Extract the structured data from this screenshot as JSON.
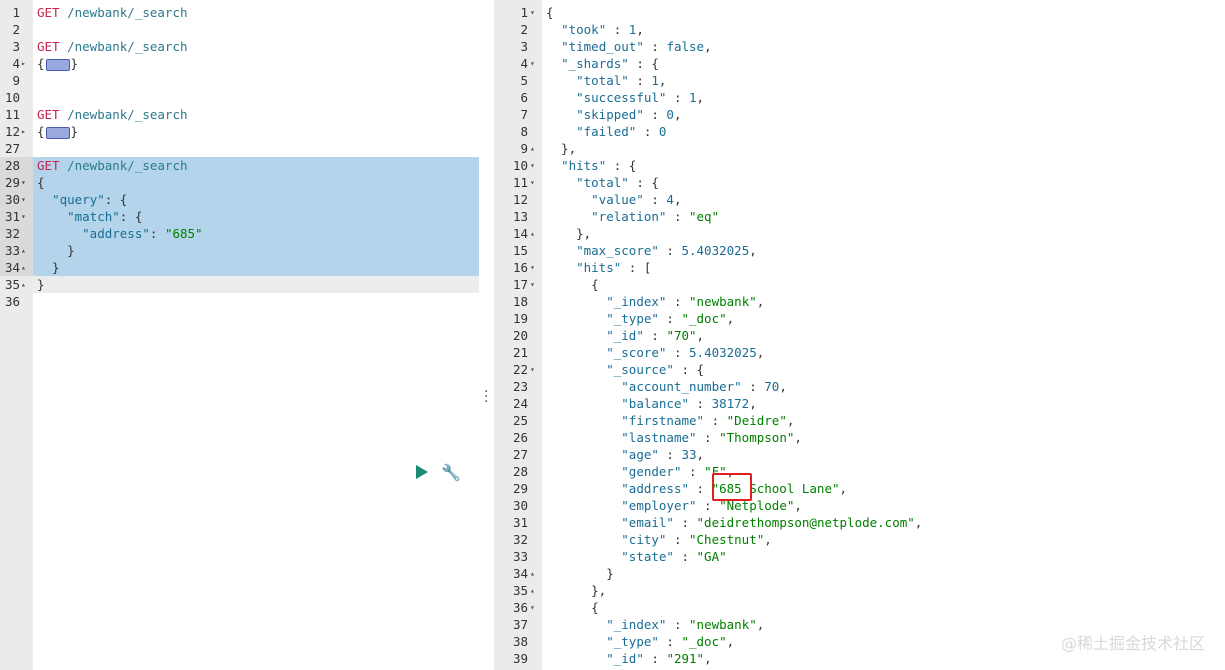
{
  "request_editor": {
    "lines": [
      {
        "n": "1",
        "fold": "",
        "parts": [
          [
            "k-method",
            "GET"
          ],
          [
            "k-path",
            " /newbank/_search"
          ]
        ]
      },
      {
        "n": "2",
        "fold": "",
        "parts": []
      },
      {
        "n": "3",
        "fold": "",
        "parts": [
          [
            "k-method",
            "GET"
          ],
          [
            "k-path",
            " /newbank/_search"
          ]
        ]
      },
      {
        "n": "4",
        "fold": "▸",
        "parts": [
          [
            "k-punc",
            "{"
          ],
          [
            "widget",
            ""
          ],
          [
            "k-punc",
            "}"
          ]
        ]
      },
      {
        "n": "9",
        "fold": "",
        "parts": []
      },
      {
        "n": "10",
        "fold": "",
        "parts": []
      },
      {
        "n": "11",
        "fold": "",
        "parts": [
          [
            "k-method",
            "GET"
          ],
          [
            "k-path",
            " /newbank/_search"
          ]
        ]
      },
      {
        "n": "12",
        "fold": "▸",
        "parts": [
          [
            "k-punc",
            "{"
          ],
          [
            "widget",
            ""
          ],
          [
            "k-punc",
            "}"
          ]
        ]
      },
      {
        "n": "27",
        "fold": "",
        "parts": []
      },
      {
        "n": "28",
        "fold": "",
        "sel": true,
        "parts": [
          [
            "k-method",
            "GET"
          ],
          [
            "k-path",
            " /newbank/_search"
          ]
        ]
      },
      {
        "n": "29",
        "fold": "▾",
        "sel": true,
        "parts": [
          [
            "k-punc",
            "{"
          ]
        ]
      },
      {
        "n": "30",
        "fold": "▾",
        "sel": true,
        "parts": [
          [
            "k-punc",
            "  "
          ],
          [
            "k-key",
            "\"query\""
          ],
          [
            "k-punc",
            ": {"
          ]
        ]
      },
      {
        "n": "31",
        "fold": "▾",
        "sel": true,
        "parts": [
          [
            "k-punc",
            "    "
          ],
          [
            "k-key",
            "\"match\""
          ],
          [
            "k-punc",
            ": {"
          ]
        ]
      },
      {
        "n": "32",
        "fold": "",
        "sel": true,
        "parts": [
          [
            "k-punc",
            "      "
          ],
          [
            "k-key",
            "\"address\""
          ],
          [
            "k-punc",
            ": "
          ],
          [
            "k-str",
            "\"685\""
          ]
        ]
      },
      {
        "n": "33",
        "fold": "▴",
        "sel": true,
        "parts": [
          [
            "k-punc",
            "    }"
          ]
        ]
      },
      {
        "n": "34",
        "fold": "▴",
        "sel": true,
        "parts": [
          [
            "k-punc",
            "  }"
          ]
        ]
      },
      {
        "n": "35",
        "fold": "▴",
        "cur": true,
        "parts": [
          [
            "k-punc",
            "}"
          ]
        ]
      },
      {
        "n": "36",
        "fold": "",
        "parts": []
      }
    ]
  },
  "response_viewer": {
    "lines": [
      {
        "n": "1",
        "fold": "▾",
        "parts": [
          [
            "k-punc",
            "{"
          ]
        ]
      },
      {
        "n": "2",
        "fold": "",
        "parts": [
          [
            "k-punc",
            "  "
          ],
          [
            "k-key",
            "\"took\""
          ],
          [
            "k-punc",
            " : "
          ],
          [
            "k-num",
            "1"
          ],
          [
            "k-punc",
            ","
          ]
        ]
      },
      {
        "n": "3",
        "fold": "",
        "parts": [
          [
            "k-punc",
            "  "
          ],
          [
            "k-key",
            "\"timed_out\""
          ],
          [
            "k-punc",
            " : "
          ],
          [
            "k-num",
            "false"
          ],
          [
            "k-punc",
            ","
          ]
        ]
      },
      {
        "n": "4",
        "fold": "▾",
        "parts": [
          [
            "k-punc",
            "  "
          ],
          [
            "k-key",
            "\"_shards\""
          ],
          [
            "k-punc",
            " : {"
          ]
        ]
      },
      {
        "n": "5",
        "fold": "",
        "parts": [
          [
            "k-punc",
            "    "
          ],
          [
            "k-key",
            "\"total\""
          ],
          [
            "k-punc",
            " : "
          ],
          [
            "k-num",
            "1"
          ],
          [
            "k-punc",
            ","
          ]
        ]
      },
      {
        "n": "6",
        "fold": "",
        "parts": [
          [
            "k-punc",
            "    "
          ],
          [
            "k-key",
            "\"successful\""
          ],
          [
            "k-punc",
            " : "
          ],
          [
            "k-num",
            "1"
          ],
          [
            "k-punc",
            ","
          ]
        ]
      },
      {
        "n": "7",
        "fold": "",
        "parts": [
          [
            "k-punc",
            "    "
          ],
          [
            "k-key",
            "\"skipped\""
          ],
          [
            "k-punc",
            " : "
          ],
          [
            "k-num",
            "0"
          ],
          [
            "k-punc",
            ","
          ]
        ]
      },
      {
        "n": "8",
        "fold": "",
        "parts": [
          [
            "k-punc",
            "    "
          ],
          [
            "k-key",
            "\"failed\""
          ],
          [
            "k-punc",
            " : "
          ],
          [
            "k-num",
            "0"
          ]
        ]
      },
      {
        "n": "9",
        "fold": "▴",
        "parts": [
          [
            "k-punc",
            "  },"
          ]
        ]
      },
      {
        "n": "10",
        "fold": "▾",
        "parts": [
          [
            "k-punc",
            "  "
          ],
          [
            "k-key",
            "\"hits\""
          ],
          [
            "k-punc",
            " : {"
          ]
        ]
      },
      {
        "n": "11",
        "fold": "▾",
        "parts": [
          [
            "k-punc",
            "    "
          ],
          [
            "k-key",
            "\"total\""
          ],
          [
            "k-punc",
            " : {"
          ]
        ]
      },
      {
        "n": "12",
        "fold": "",
        "parts": [
          [
            "k-punc",
            "      "
          ],
          [
            "k-key",
            "\"value\""
          ],
          [
            "k-punc",
            " : "
          ],
          [
            "k-num",
            "4"
          ],
          [
            "k-punc",
            ","
          ]
        ]
      },
      {
        "n": "13",
        "fold": "",
        "parts": [
          [
            "k-punc",
            "      "
          ],
          [
            "k-key",
            "\"relation\""
          ],
          [
            "k-punc",
            " : "
          ],
          [
            "k-str",
            "\"eq\""
          ]
        ]
      },
      {
        "n": "14",
        "fold": "▴",
        "parts": [
          [
            "k-punc",
            "    },"
          ]
        ]
      },
      {
        "n": "15",
        "fold": "",
        "parts": [
          [
            "k-punc",
            "    "
          ],
          [
            "k-key",
            "\"max_score\""
          ],
          [
            "k-punc",
            " : "
          ],
          [
            "k-num",
            "5.4032025"
          ],
          [
            "k-punc",
            ","
          ]
        ]
      },
      {
        "n": "16",
        "fold": "▾",
        "parts": [
          [
            "k-punc",
            "    "
          ],
          [
            "k-key",
            "\"hits\""
          ],
          [
            "k-punc",
            " : ["
          ]
        ]
      },
      {
        "n": "17",
        "fold": "▾",
        "parts": [
          [
            "k-punc",
            "      {"
          ]
        ]
      },
      {
        "n": "18",
        "fold": "",
        "parts": [
          [
            "k-punc",
            "        "
          ],
          [
            "k-key",
            "\"_index\""
          ],
          [
            "k-punc",
            " : "
          ],
          [
            "k-str",
            "\"newbank\""
          ],
          [
            "k-punc",
            ","
          ]
        ]
      },
      {
        "n": "19",
        "fold": "",
        "parts": [
          [
            "k-punc",
            "        "
          ],
          [
            "k-key",
            "\"_type\""
          ],
          [
            "k-punc",
            " : "
          ],
          [
            "k-str",
            "\"_doc\""
          ],
          [
            "k-punc",
            ","
          ]
        ]
      },
      {
        "n": "20",
        "fold": "",
        "parts": [
          [
            "k-punc",
            "        "
          ],
          [
            "k-key",
            "\"_id\""
          ],
          [
            "k-punc",
            " : "
          ],
          [
            "k-str",
            "\"70\""
          ],
          [
            "k-punc",
            ","
          ]
        ]
      },
      {
        "n": "21",
        "fold": "",
        "parts": [
          [
            "k-punc",
            "        "
          ],
          [
            "k-key",
            "\"_score\""
          ],
          [
            "k-punc",
            " : "
          ],
          [
            "k-num",
            "5.4032025"
          ],
          [
            "k-punc",
            ","
          ]
        ]
      },
      {
        "n": "22",
        "fold": "▾",
        "parts": [
          [
            "k-punc",
            "        "
          ],
          [
            "k-key",
            "\"_source\""
          ],
          [
            "k-punc",
            " : {"
          ]
        ]
      },
      {
        "n": "23",
        "fold": "",
        "parts": [
          [
            "k-punc",
            "          "
          ],
          [
            "k-key",
            "\"account_number\""
          ],
          [
            "k-punc",
            " : "
          ],
          [
            "k-num",
            "70"
          ],
          [
            "k-punc",
            ","
          ]
        ]
      },
      {
        "n": "24",
        "fold": "",
        "parts": [
          [
            "k-punc",
            "          "
          ],
          [
            "k-key",
            "\"balance\""
          ],
          [
            "k-punc",
            " : "
          ],
          [
            "k-num",
            "38172"
          ],
          [
            "k-punc",
            ","
          ]
        ]
      },
      {
        "n": "25",
        "fold": "",
        "parts": [
          [
            "k-punc",
            "          "
          ],
          [
            "k-key",
            "\"firstname\""
          ],
          [
            "k-punc",
            " : "
          ],
          [
            "k-str",
            "\"Deidre\""
          ],
          [
            "k-punc",
            ","
          ]
        ]
      },
      {
        "n": "26",
        "fold": "",
        "parts": [
          [
            "k-punc",
            "          "
          ],
          [
            "k-key",
            "\"lastname\""
          ],
          [
            "k-punc",
            " : "
          ],
          [
            "k-str",
            "\"Thompson\""
          ],
          [
            "k-punc",
            ","
          ]
        ]
      },
      {
        "n": "27",
        "fold": "",
        "parts": [
          [
            "k-punc",
            "          "
          ],
          [
            "k-key",
            "\"age\""
          ],
          [
            "k-punc",
            " : "
          ],
          [
            "k-num",
            "33"
          ],
          [
            "k-punc",
            ","
          ]
        ]
      },
      {
        "n": "28",
        "fold": "",
        "parts": [
          [
            "k-punc",
            "          "
          ],
          [
            "k-key",
            "\"gender\""
          ],
          [
            "k-punc",
            " : "
          ],
          [
            "k-str",
            "\"F\""
          ],
          [
            "k-punc",
            ","
          ]
        ]
      },
      {
        "n": "29",
        "fold": "",
        "parts": [
          [
            "k-punc",
            "          "
          ],
          [
            "k-key",
            "\"address\""
          ],
          [
            "k-punc",
            " : "
          ],
          [
            "k-str",
            "\"685 School Lane\""
          ],
          [
            "k-punc",
            ","
          ]
        ]
      },
      {
        "n": "30",
        "fold": "",
        "parts": [
          [
            "k-punc",
            "          "
          ],
          [
            "k-key",
            "\"employer\""
          ],
          [
            "k-punc",
            " : "
          ],
          [
            "k-str",
            "\"Netplode\""
          ],
          [
            "k-punc",
            ","
          ]
        ]
      },
      {
        "n": "31",
        "fold": "",
        "parts": [
          [
            "k-punc",
            "          "
          ],
          [
            "k-key",
            "\"email\""
          ],
          [
            "k-punc",
            " : "
          ],
          [
            "k-str",
            "\"deidrethompson@netplode.com\""
          ],
          [
            "k-punc",
            ","
          ]
        ]
      },
      {
        "n": "32",
        "fold": "",
        "parts": [
          [
            "k-punc",
            "          "
          ],
          [
            "k-key",
            "\"city\""
          ],
          [
            "k-punc",
            " : "
          ],
          [
            "k-str",
            "\"Chestnut\""
          ],
          [
            "k-punc",
            ","
          ]
        ]
      },
      {
        "n": "33",
        "fold": "",
        "parts": [
          [
            "k-punc",
            "          "
          ],
          [
            "k-key",
            "\"state\""
          ],
          [
            "k-punc",
            " : "
          ],
          [
            "k-str",
            "\"GA\""
          ]
        ]
      },
      {
        "n": "34",
        "fold": "▴",
        "parts": [
          [
            "k-punc",
            "        }"
          ]
        ]
      },
      {
        "n": "35",
        "fold": "▴",
        "parts": [
          [
            "k-punc",
            "      },"
          ]
        ]
      },
      {
        "n": "36",
        "fold": "▾",
        "parts": [
          [
            "k-punc",
            "      {"
          ]
        ]
      },
      {
        "n": "37",
        "fold": "",
        "parts": [
          [
            "k-punc",
            "        "
          ],
          [
            "k-key",
            "\"_index\""
          ],
          [
            "k-punc",
            " : "
          ],
          [
            "k-str",
            "\"newbank\""
          ],
          [
            "k-punc",
            ","
          ]
        ]
      },
      {
        "n": "38",
        "fold": "",
        "parts": [
          [
            "k-punc",
            "        "
          ],
          [
            "k-key",
            "\"_type\""
          ],
          [
            "k-punc",
            " : "
          ],
          [
            "k-str",
            "\"_doc\""
          ],
          [
            "k-punc",
            ","
          ]
        ]
      },
      {
        "n": "39",
        "fold": "",
        "parts": [
          [
            "k-punc",
            "        "
          ],
          [
            "k-key",
            "\"_id\""
          ],
          [
            "k-punc",
            " : "
          ],
          [
            "k-str",
            "\"291\""
          ],
          [
            "k-punc",
            ","
          ]
        ]
      }
    ]
  },
  "toolbar": {
    "run_icon": "play-icon",
    "settings_icon": "wrench-icon",
    "divider_icon": "vertical-dots-icon"
  },
  "watermark": "@稀土掘金技术社区",
  "colors": {
    "selection": "#b3d4ea",
    "gutter": "#ebebeb",
    "highlight_border": "#e02020",
    "run_button": "#1a8a6e"
  }
}
